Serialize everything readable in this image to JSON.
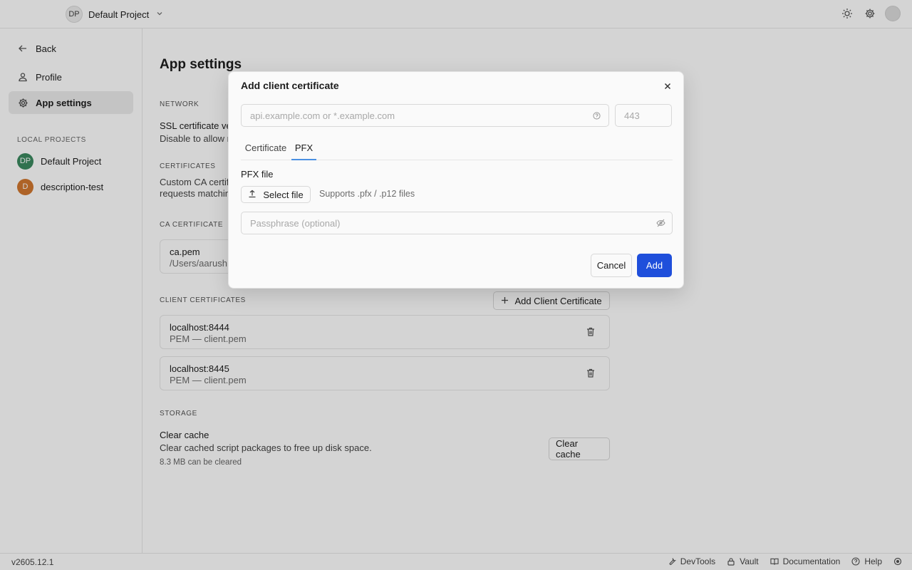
{
  "topbar": {
    "project_initials": "DP",
    "project_name": "Default Project"
  },
  "sidebar": {
    "back_label": "Back",
    "items": [
      {
        "label": "Profile"
      },
      {
        "label": "App settings"
      }
    ],
    "projects_heading": "LOCAL PROJECTS",
    "projects": [
      {
        "initials": "DP",
        "name": "Default Project",
        "color": "#3b8a5f"
      },
      {
        "initials": "D",
        "name": "description-test",
        "color": "#d2782f"
      }
    ]
  },
  "main": {
    "title": "App settings",
    "network_heading": "NETWORK",
    "ssl_title": "SSL certificate ve",
    "ssl_desc": "Disable to allow r",
    "certificates_heading": "CERTIFICATES",
    "certificates_desc_1": "Custom CA certif",
    "certificates_desc_2": "requests matchin",
    "ca_heading": "CA CERTIFICATE",
    "ca_card": {
      "title": "ca.pem",
      "path": "/Users/aarush"
    },
    "client_heading": "CLIENT CERTIFICATES",
    "add_client_label": "Add Client Certificate",
    "client_certs": [
      {
        "host": "localhost:8444",
        "desc": "PEM — client.pem"
      },
      {
        "host": "localhost:8445",
        "desc": "PEM — client.pem"
      }
    ],
    "storage_heading": "STORAGE",
    "clear_cache_title": "Clear cache",
    "clear_cache_desc": "Clear cached script packages to free up disk space.",
    "clear_cache_size": "8.3 MB can be cleared",
    "clear_cache_button": "Clear cache"
  },
  "statusbar": {
    "version": "v2605.12.1",
    "links": [
      "DevTools",
      "Vault",
      "Documentation",
      "Help"
    ]
  },
  "modal": {
    "title": "Add client certificate",
    "host_placeholder": "api.example.com or *.example.com",
    "port_placeholder": "443",
    "tabs": [
      "Certificate",
      "PFX"
    ],
    "active_tab": "PFX",
    "pfx_label": "PFX file",
    "select_file_label": "Select file",
    "supports_text": "Supports .pfx / .p12 files",
    "passphrase_placeholder": "Passphrase (optional)",
    "cancel_label": "Cancel",
    "add_label": "Add"
  },
  "colors": {
    "primary": "#1f4fdb",
    "tab_underline": "#4a90e2"
  }
}
